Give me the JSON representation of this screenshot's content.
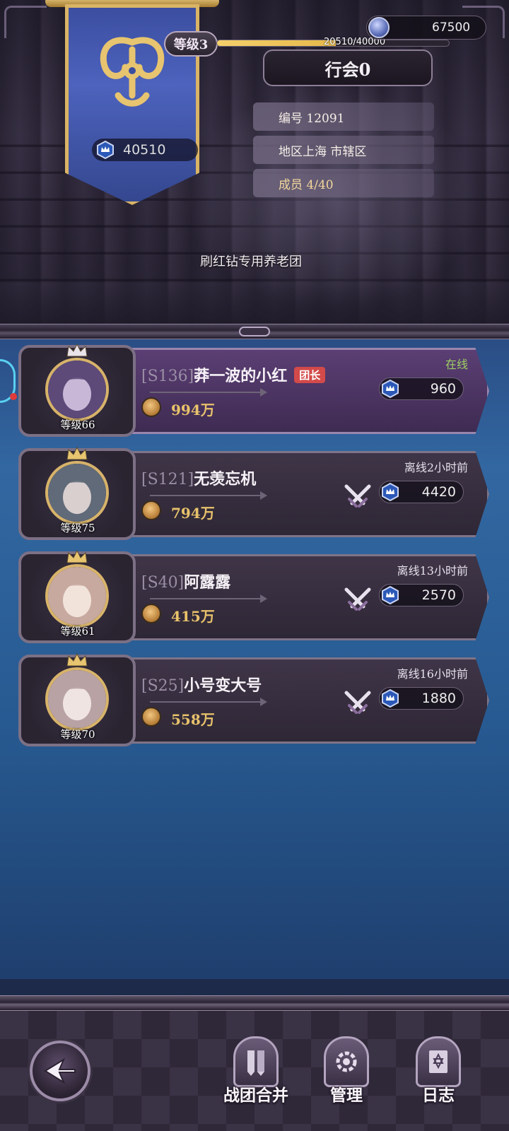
{
  "header": {
    "currency": {
      "icon": "gem-coin-icon",
      "amount": "67500"
    },
    "level": "等级3",
    "experience": {
      "text": "20510/40000",
      "progress": 0.51275
    },
    "guild_name": "行会0",
    "banner_score": "40510",
    "info": {
      "id": "编号 12091",
      "region": "地区上海 市辖区",
      "members": "成员 4/40"
    },
    "motto": "刷红钻专用养老团"
  },
  "members": [
    {
      "server": "[S136]",
      "name": "莽一波的小红",
      "tag": "团长",
      "level": "等级66",
      "power": "994万",
      "status": "在线",
      "contribution": "960",
      "status_color": "#9ecf64"
    },
    {
      "server": "[S121]",
      "name": "无羡忘机",
      "level": "等级75",
      "power": "794万",
      "status": "离线2小时前",
      "contribution": "4420"
    },
    {
      "server": "[S40]",
      "name": "阿露露",
      "level": "等级61",
      "power": "415万",
      "status": "离线13小时前",
      "contribution": "2570"
    },
    {
      "server": "[S25]",
      "name": "小号变大号",
      "level": "等级70",
      "power": "558万",
      "status": "离线16小时前",
      "contribution": "1880"
    }
  ],
  "bottom_nav": {
    "back_icon": "back-arrow-icon",
    "merge": "战团合并",
    "manage": "管理",
    "log": "日志"
  },
  "colors": {
    "accent_gold": "#e8c26b",
    "online_green": "#9ecf64",
    "leader_tag": "#d34a4a"
  }
}
